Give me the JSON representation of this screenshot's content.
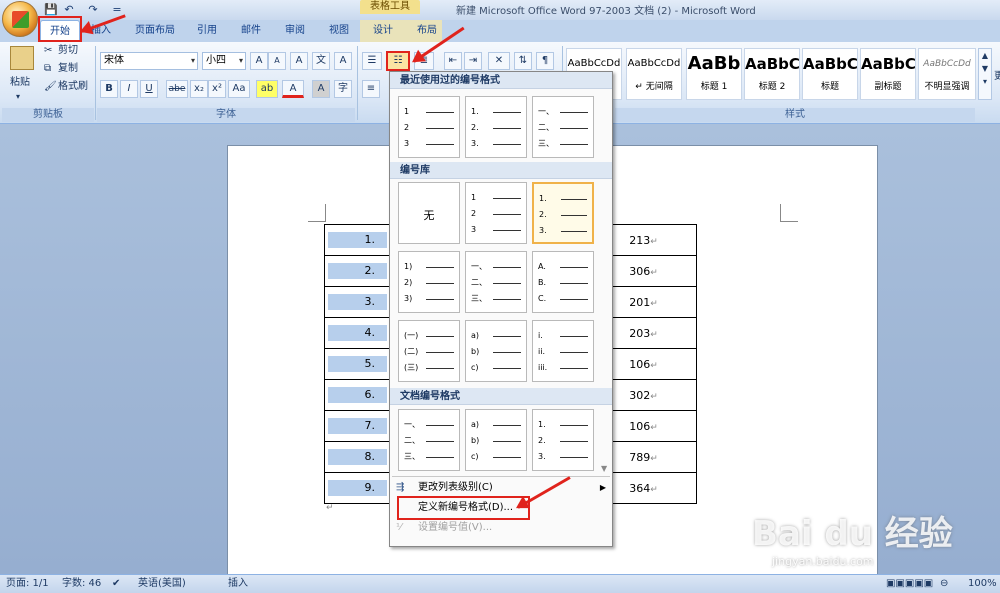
{
  "window": {
    "title": "新建 Microsoft Office Word 97-2003 文档 (2) - Microsoft Word",
    "contextual_tab_group": "表格工具"
  },
  "quick_access": {
    "customize": "="
  },
  "tabs": [
    "开始",
    "插入",
    "页面布局",
    "引用",
    "邮件",
    "审阅",
    "视图",
    "设计",
    "布局"
  ],
  "clipboard": {
    "paste": "粘贴",
    "cut": "剪切",
    "copy": "复制",
    "format_painter": "格式刷",
    "group": "剪贴板"
  },
  "font": {
    "name": "宋体",
    "size": "小四",
    "group": "字体",
    "bold": "B",
    "italic": "I",
    "underline": "U",
    "strike": "abe",
    "sub": "x₂",
    "sup": "x²",
    "case": "Aa",
    "grow": "A",
    "shrink": "A",
    "highlight": "ab",
    "color": "A",
    "char_shade": "A",
    "clear": "A"
  },
  "styles": {
    "group": "样式",
    "items": [
      {
        "sample": "AaBbCcDd",
        "name": ""
      },
      {
        "sample": "AaBbCcDd",
        "name": "↵ 无间隔"
      },
      {
        "sample": "AaBb",
        "name": "标题 1"
      },
      {
        "sample": "AaBbC",
        "name": "标题 2"
      },
      {
        "sample": "AaBbC",
        "name": "标题"
      },
      {
        "sample": "AaBbC",
        "name": "副标题"
      },
      {
        "sample": "AaBbCcDd",
        "name": "不明显强调"
      }
    ],
    "change_styles": "更"
  },
  "dropdown": {
    "recent_header": "最近使用过的编号格式",
    "library_header": "编号库",
    "document_header": "文档编号格式",
    "none_label": "无",
    "recent": [
      [
        "1",
        "2",
        "3"
      ],
      [
        "1.",
        "2.",
        "3."
      ],
      [
        "一、",
        "二、",
        "三、"
      ]
    ],
    "library": [
      [
        "",
        "",
        ""
      ],
      [
        "1",
        "2",
        "3"
      ],
      [
        "1.",
        "2.",
        "3."
      ],
      [
        "1)",
        "2)",
        "3)"
      ],
      [
        "一、",
        "二、",
        "三、"
      ],
      [
        "A.",
        "B.",
        "C."
      ],
      [
        "(一)",
        "(二)",
        "(三)"
      ],
      [
        "a)",
        "b)",
        "c)"
      ],
      [
        "i.",
        "ii.",
        "iii."
      ]
    ],
    "document": [
      [
        "一、",
        "二、",
        "三、"
      ],
      [
        "a)",
        "b)",
        "c)"
      ],
      [
        "1.",
        "2.",
        "3."
      ]
    ],
    "change_level": "更改列表级别(C)",
    "define_new": "定义新编号格式(D)...",
    "set_value": "设置编号值(V)..."
  },
  "table": {
    "rows": [
      {
        "num": "1.",
        "value": "213"
      },
      {
        "num": "2.",
        "value": "306"
      },
      {
        "num": "3.",
        "value": "201"
      },
      {
        "num": "4.",
        "value": "203"
      },
      {
        "num": "5.",
        "value": "106"
      },
      {
        "num": "6.",
        "value": "302"
      },
      {
        "num": "7.",
        "value": "106"
      },
      {
        "num": "8.",
        "value": "789"
      },
      {
        "num": "9.",
        "value": "364"
      }
    ],
    "para_mark": "↵"
  },
  "status": {
    "page": "页面: 1/1",
    "words": "字数: 46",
    "language": "英语(美国)",
    "mode": "插入",
    "zoom": "100%"
  },
  "watermark": {
    "logo": "Bai du 经验",
    "url": "jingyan.baidu.com"
  },
  "colors": {
    "accent_red": "#e0231c",
    "ribbon_blue": "#dbe7f6",
    "selection_blue": "#b7cfec"
  }
}
